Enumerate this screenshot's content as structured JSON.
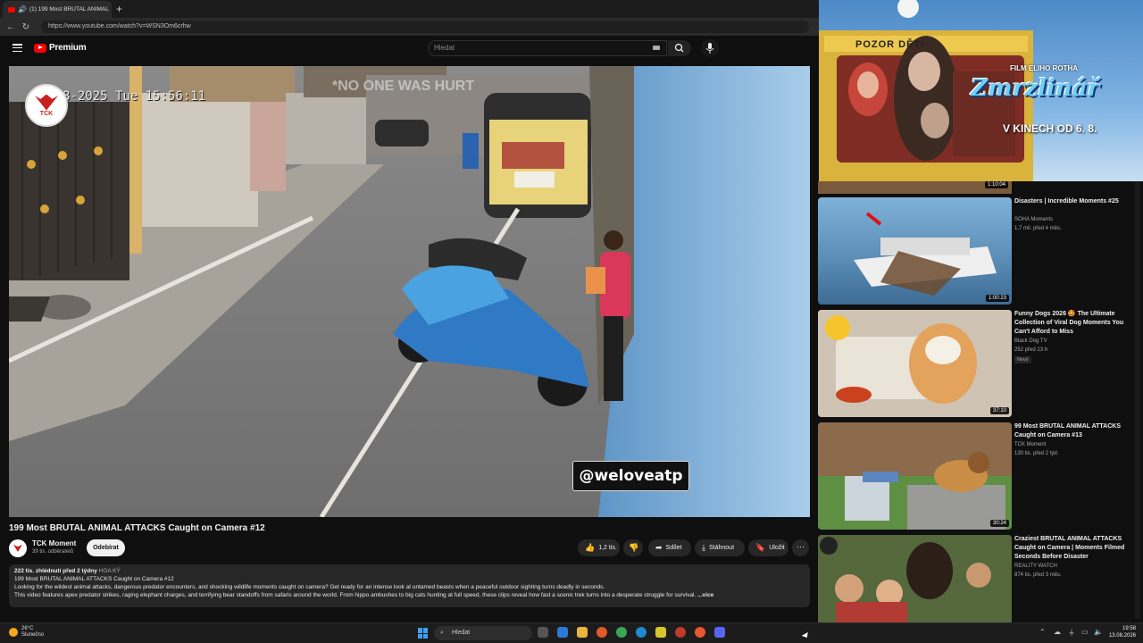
{
  "browser": {
    "tab_title": "(1) 199 Most BRUTAL ANIMAL",
    "url": "https://www.youtube.com/watch?v=WSN3Om6crhw"
  },
  "header": {
    "logo_text": "Premium",
    "search_placeholder": "Hledat"
  },
  "video": {
    "timestamp_overlay": "8-2025 Tue  15:56:11",
    "text_overlay": "*NO ONE WAS HURT",
    "channel_logo_text": "TCK",
    "handle_watermark": "@weloveatp",
    "title": "199 Most BRUTAL ANIMAL ATTACKS Caught on Camera #12"
  },
  "channel": {
    "name": "TCK Moment",
    "subscribers": "39 tis. odběratelů",
    "subscribe_label": "Odebírat"
  },
  "actions": {
    "likes": "1,2 tis.",
    "share": "Sdílet",
    "download": "Stáhnout",
    "save": "Uložit"
  },
  "description": {
    "meta": "222 tis. zhlédnutí  před 2 týdny",
    "hashtag": "HOA KỲ",
    "line1": "199 Most BRUTAL ANIMAL ATTACKS Caught on Camera #12",
    "line2": "Looking for the wildest animal attacks, dangerous predator encounters, and shocking wildlife moments caught on camera? Get ready for an intense look at untamed beasts when a peaceful outdoor sighting turns deadly in seconds.",
    "line3": "This video features apex predator strikes, raging elephant charges, and terrifying bear standoffs from safaris around the world. From hippo ambushes to big cats hunting at full speed, these clips reveal how fast a scenic trek turns into a desperate struggle for survival.",
    "more": "...více"
  },
  "ad": {
    "sign_text": "POZOR DĚTI",
    "film_by": "FILM ELIHO ROTHA",
    "title": "Zmrzlinář",
    "date": "V KINECH OD 6. 8."
  },
  "recommendations": [
    {
      "title": "Disasters | Incredible Moments #25",
      "channel": "SOHA Moments",
      "meta": "1,7 mil.  před 4 měs.",
      "duration": "1:00:23",
      "prev_duration": "1:10:04",
      "badge": ""
    },
    {
      "title": "Funny Dogs 2026 🤩 The Ultimate Collection of Viral Dog Moments You Can't Afford to Miss",
      "channel": "Black Dog TV",
      "meta": "252  před 13 h",
      "duration": "37:10",
      "badge": "Nový"
    },
    {
      "title": "99 Most BRUTAL ANIMAL ATTACKS Caught on Camera #13",
      "channel": "TCK Moment",
      "meta": "130 tis.  před 2 týd.",
      "duration": "30:24",
      "badge": ""
    },
    {
      "title": "Craziest BRUTAL ANIMAL ATTACKS Caught on Camera | Moments Filmed Seconds Before Disaster",
      "channel": "REALITY WATCH",
      "meta": "874 tis.  před 3 měs.",
      "duration": "",
      "badge": ""
    }
  ],
  "taskbar": {
    "temperature": "26°C",
    "weather": "Slunečno",
    "search": "Hledat",
    "time": "19:58",
    "date": "13.08.2026"
  },
  "colors": {
    "accent_red": "#ff0000",
    "background": "#0f0f0f",
    "surface": "#272727"
  }
}
